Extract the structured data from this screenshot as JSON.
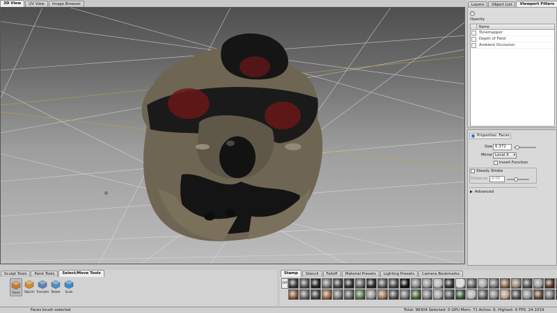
{
  "viewport_tabs": [
    {
      "label": "3D View",
      "active": true
    },
    {
      "label": "UV View",
      "active": false
    },
    {
      "label": "Image Browser",
      "active": false
    }
  ],
  "right_tabs": [
    {
      "label": "Layers",
      "active": false
    },
    {
      "label": "Object List",
      "active": false
    },
    {
      "label": "Viewport Filters",
      "active": true
    }
  ],
  "viewport_filters": {
    "opacity_label": "Opacity",
    "column_header": "Name",
    "items": [
      "Tonemapper",
      "Depth of Field",
      "Ambient Occlusion"
    ]
  },
  "properties": {
    "title": "Properties: Faces",
    "size_label": "Size",
    "size_value": "6.372",
    "mirror_label": "Mirror",
    "mirror_value": "Local X",
    "invert_label": "Invert Function",
    "steady_label": "Steady Stroke",
    "distance_label": "Distance",
    "distance_value": "4.00",
    "advanced_label": "Advanced"
  },
  "tool_tabs": [
    {
      "label": "Sculpt Tools",
      "active": false
    },
    {
      "label": "Paint Tools",
      "active": false
    },
    {
      "label": "Select/Move Tools",
      "active": true
    }
  ],
  "tools": [
    {
      "label": "Faces",
      "icon": "faces-tool-icon",
      "selected": true
    },
    {
      "label": "Objects",
      "icon": "objects-tool-icon",
      "selected": false
    },
    {
      "label": "Translate",
      "icon": "translate-tool-icon",
      "selected": false
    },
    {
      "label": "Rotate",
      "icon": "rotate-tool-icon",
      "selected": false
    },
    {
      "label": "Scale",
      "icon": "scale-tool-icon",
      "selected": false
    }
  ],
  "tray_tabs": [
    {
      "label": "Stamp",
      "active": true
    },
    {
      "label": "Stencil",
      "active": false
    },
    {
      "label": "Falloff",
      "active": false
    },
    {
      "label": "Material Presets",
      "active": false
    },
    {
      "label": "Lighting Presets",
      "active": false
    },
    {
      "label": "Camera Bookmarks",
      "active": false
    }
  ],
  "stamp_off_label": "Off",
  "status": {
    "message": "Faces brush selected",
    "stats": "Total: 98304  Selected: 0  GPU Mem: 71  Active: 6, Highest: 6  FPS: 24.1019"
  },
  "colors": {
    "model_body": "#6e6553",
    "model_dark": "#151515",
    "eye_red": "#8a1a1a",
    "grid_line": "#dcdcdc",
    "grid_axis": "#c9a14a"
  }
}
